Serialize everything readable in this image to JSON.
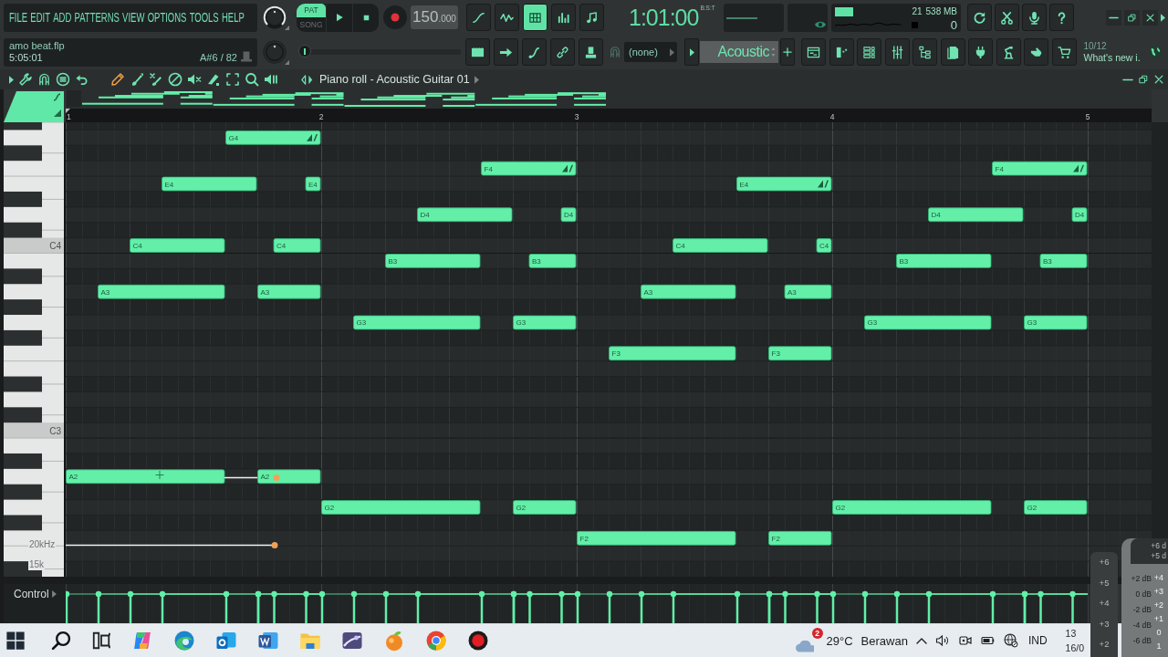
{
  "menu": [
    "FILE",
    "EDIT",
    "ADD",
    "PATTERNS",
    "VIEW",
    "OPTIONS",
    "TOOLS",
    "HELP"
  ],
  "project": {
    "file": "amo beat.flp",
    "time": "5:05:01",
    "note_info": "A#6 / 82"
  },
  "transport": {
    "modes": [
      {
        "label": "PAT",
        "selected": true
      },
      {
        "label": "SONG",
        "selected": false
      }
    ],
    "tempo": "150",
    "tempo_decimals": ".000",
    "song_position": {
      "level": 0.04
    }
  },
  "tool_buttons": [
    {
      "selected": false
    },
    {
      "selected": false
    },
    {
      "selected": true
    },
    {
      "selected": false
    },
    {
      "selected": false
    }
  ],
  "time_display": {
    "value": "1:01:00",
    "format": "B:S:T"
  },
  "monitor": {
    "cpu": "21",
    "memory": "538 MB",
    "voices": "0"
  },
  "channel": {
    "mixer_target": "(none)",
    "name": "Acoustic"
  },
  "news": {
    "count": "10/12",
    "headline": "What's new i."
  },
  "piano_roll": {
    "title": "Piano roll - Acoustic Guitar 01",
    "tools": [
      {
        "selected": true
      },
      {
        "selected": false
      },
      {
        "selected": false
      },
      {
        "selected": false
      },
      {
        "selected": false
      },
      {
        "selected": false
      },
      {
        "selected": false
      },
      {
        "selected": false
      },
      {
        "selected": false
      }
    ],
    "chart_data": {
      "type": "bar",
      "orientation": "horizontal",
      "grid": true,
      "xlim": [
        1,
        5.25
      ],
      "xticks": [
        1,
        2,
        3,
        4,
        5
      ],
      "categories": [
        null,
        null,
        null,
        null,
        null,
        null,
        null,
        null,
        "C4",
        null,
        null,
        null,
        null,
        null,
        null,
        null,
        null,
        null,
        null,
        null,
        "C3",
        null,
        null,
        null,
        null,
        null,
        null,
        null,
        null,
        null
      ],
      "series": [
        {
          "color": "#63efa8",
          "base": [
            null,
            null,
            null,
            null,
            1.375,
            null,
            2.375,
            null,
            1.25,
            2.25,
            null,
            1.125,
            null,
            2.125,
            null,
            3.125,
            null,
            null,
            null,
            null,
            null,
            null,
            null,
            1,
            null,
            2,
            null,
            3,
            null,
            null
          ],
          "values": [
            null,
            null,
            null,
            null,
            0.375,
            null,
            0.375,
            null,
            0.375,
            0.375,
            null,
            0.5,
            null,
            0.5,
            null,
            0.5,
            null,
            null,
            null,
            null,
            null,
            null,
            null,
            0.625,
            null,
            0.625,
            null,
            0.625,
            null,
            null
          ],
          "value_labels": [
            null,
            null,
            null,
            null,
            "E4",
            null,
            "D4",
            null,
            "C4",
            "B3",
            null,
            "A3",
            null,
            "G3",
            null,
            "F3",
            null,
            null,
            null,
            null,
            null,
            null,
            null,
            "A2",
            null,
            "G2",
            null,
            "F2",
            null,
            null
          ]
        },
        {
          "color": "#63efa8",
          "base": [
            null,
            null,
            null,
            null,
            1.9375,
            null,
            2.9375,
            null,
            1.8125,
            2.8125,
            null,
            1.75,
            null,
            2.75,
            null,
            3.75,
            null,
            null,
            null,
            null,
            null,
            null,
            null,
            1.75,
            null,
            2.75,
            null,
            3.75,
            null,
            null
          ],
          "values": [
            null,
            null,
            null,
            null,
            0.0625,
            null,
            0.0625,
            null,
            0.1875,
            0.1875,
            null,
            0.25,
            null,
            0.25,
            null,
            0.25,
            null,
            null,
            null,
            null,
            null,
            null,
            null,
            0.25,
            null,
            0.25,
            null,
            0.25,
            null,
            null
          ],
          "value_labels": [
            null,
            null,
            null,
            null,
            "E4",
            null,
            "D4",
            null,
            "C4",
            "B3",
            null,
            "A3",
            null,
            "G3",
            null,
            "F3",
            null,
            null,
            null,
            null,
            null,
            null,
            null,
            "A2",
            null,
            "G2",
            null,
            "F2",
            null,
            null
          ]
        },
        {
          "color": "#63efa8",
          "base": [
            null,
            null,
            null,
            null,
            null,
            null,
            4.375,
            null,
            3.375,
            4.25,
            null,
            3.25,
            null,
            4.125,
            null,
            null,
            null,
            null,
            null,
            null,
            null,
            null,
            null,
            null,
            null,
            4,
            null,
            null,
            null,
            null
          ],
          "values": [
            null,
            null,
            null,
            null,
            null,
            null,
            0.375,
            null,
            0.375,
            0.375,
            null,
            0.375,
            null,
            0.5,
            null,
            null,
            null,
            null,
            null,
            null,
            null,
            null,
            null,
            null,
            null,
            0.625,
            null,
            null,
            null,
            null
          ],
          "value_labels": [
            null,
            null,
            null,
            null,
            null,
            null,
            "D4",
            null,
            "C4",
            "B3",
            null,
            "A3",
            null,
            "G3",
            null,
            null,
            null,
            null,
            null,
            null,
            null,
            null,
            null,
            null,
            null,
            "G2",
            null,
            null,
            null,
            null
          ]
        },
        {
          "color": "#63efa8",
          "base": [
            null,
            null,
            null,
            null,
            null,
            null,
            4.9375,
            null,
            3.9375,
            4.8125,
            null,
            3.8125,
            null,
            4.75,
            null,
            null,
            null,
            null,
            null,
            null,
            null,
            null,
            null,
            null,
            null,
            4.75,
            null,
            null,
            null,
            null
          ],
          "values": [
            null,
            null,
            null,
            null,
            null,
            null,
            0.0625,
            null,
            0.0625,
            0.1875,
            null,
            0.1875,
            null,
            0.25,
            null,
            null,
            null,
            null,
            null,
            null,
            null,
            null,
            null,
            null,
            null,
            0.25,
            null,
            null,
            null,
            null
          ],
          "value_labels": [
            null,
            null,
            null,
            null,
            null,
            null,
            "D4",
            null,
            "C4",
            "B3",
            null,
            "A3",
            null,
            "G3",
            null,
            null,
            null,
            null,
            null,
            null,
            null,
            null,
            null,
            null,
            null,
            "G2",
            null,
            null,
            null,
            null
          ]
        },
        {
          "color": "#63efa8",
          "marker": "ramp",
          "base": [
            null,
            1.625,
            null,
            2.625,
            3.625,
            null,
            null,
            null,
            null,
            null,
            null,
            null,
            null,
            null,
            null,
            null,
            null,
            null,
            null,
            null,
            null,
            null,
            null,
            null,
            null,
            null,
            null,
            null,
            null,
            null
          ],
          "values": [
            null,
            0.375,
            null,
            0.375,
            0.375,
            null,
            null,
            null,
            null,
            null,
            null,
            null,
            null,
            null,
            null,
            null,
            null,
            null,
            null,
            null,
            null,
            null,
            null,
            null,
            null,
            null,
            null,
            null,
            null,
            null
          ],
          "value_labels": [
            null,
            "G4",
            null,
            "F4",
            "E4",
            null,
            null,
            null,
            null,
            null,
            null,
            null,
            null,
            null,
            null,
            null,
            null,
            null,
            null,
            null,
            null,
            null,
            null,
            null,
            null,
            null,
            null,
            null,
            null,
            null
          ]
        },
        {
          "color": "#63efa8",
          "marker": "ramp",
          "base": [
            null,
            null,
            null,
            4.625,
            null,
            null,
            null,
            null,
            null,
            null,
            null,
            null,
            null,
            null,
            null,
            null,
            null,
            null,
            null,
            null,
            null,
            null,
            null,
            null,
            null,
            null,
            null,
            null,
            null,
            null
          ],
          "values": [
            null,
            null,
            null,
            0.375,
            null,
            null,
            null,
            null,
            null,
            null,
            null,
            null,
            null,
            null,
            null,
            null,
            null,
            null,
            null,
            null,
            null,
            null,
            null,
            null,
            null,
            null,
            null,
            null,
            null,
            null
          ],
          "value_labels": [
            null,
            null,
            null,
            "F4",
            null,
            null,
            null,
            null,
            null,
            null,
            null,
            null,
            null,
            null,
            null,
            null,
            null,
            null,
            null,
            null,
            null,
            null,
            null,
            null,
            null,
            null,
            null,
            null,
            null,
            null
          ]
        }
      ]
    },
    "event_lane": {
      "label": "Control"
    }
  },
  "overlay": {
    "frequency_labels": [
      "20kHz",
      "15k"
    ],
    "meter_scale": [
      "+6",
      "+5",
      "+4",
      "+3",
      "+2"
    ],
    "db_top": [
      "+6 d",
      "+5 d"
    ],
    "db_scale": [
      "+2 dB",
      "0 dB",
      "-2 dB",
      "-4 dB",
      "-6 dB"
    ],
    "faint_scale": [
      "+4",
      "+3",
      "+2",
      "+1",
      "0",
      "1"
    ]
  },
  "taskbar": {
    "weather_badge": "2",
    "temperature": "29°C",
    "weather": "Berawan",
    "language": "IND",
    "clock": [
      "13",
      "16/0"
    ]
  }
}
